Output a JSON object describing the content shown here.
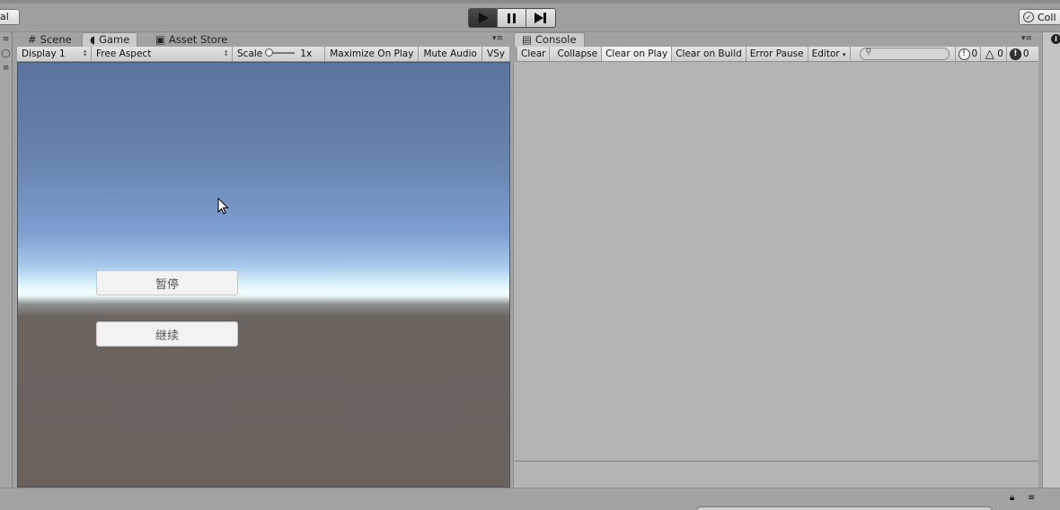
{
  "toolbar": {
    "left_button_label": "al",
    "play_controls": [
      {
        "name": "play",
        "icon": "play-icon",
        "active": true
      },
      {
        "name": "pause",
        "icon": "pause-icon",
        "active": false
      },
      {
        "name": "step",
        "icon": "step-icon",
        "active": false
      }
    ],
    "collab_label": "Coll"
  },
  "game_panel": {
    "tabs": [
      {
        "label": "Scene",
        "icon": "scene-grid-icon",
        "selected": false
      },
      {
        "label": "Game",
        "icon": "game-pacman-icon",
        "selected": true
      },
      {
        "label": "Asset Store",
        "icon": "store-bag-icon",
        "selected": false
      }
    ],
    "toolbar": {
      "display": "Display 1",
      "aspect": "Free Aspect",
      "scale_label": "Scale",
      "scale_value": "1x",
      "maximize": "Maximize On Play",
      "mute": "Mute Audio",
      "vsync": "VSy"
    },
    "ui_buttons": {
      "pause": "暂停",
      "resume": "继续"
    }
  },
  "console_panel": {
    "tab_label": "Console",
    "buttons": {
      "clear": "Clear",
      "collapse": "Collapse",
      "clear_on_play": "Clear on Play",
      "clear_on_build": "Clear on Build",
      "error_pause": "Error Pause",
      "editor": "Editor"
    },
    "search": {
      "placeholder": ""
    },
    "counts": {
      "info": "0",
      "warnings": "0",
      "errors": "0"
    }
  }
}
